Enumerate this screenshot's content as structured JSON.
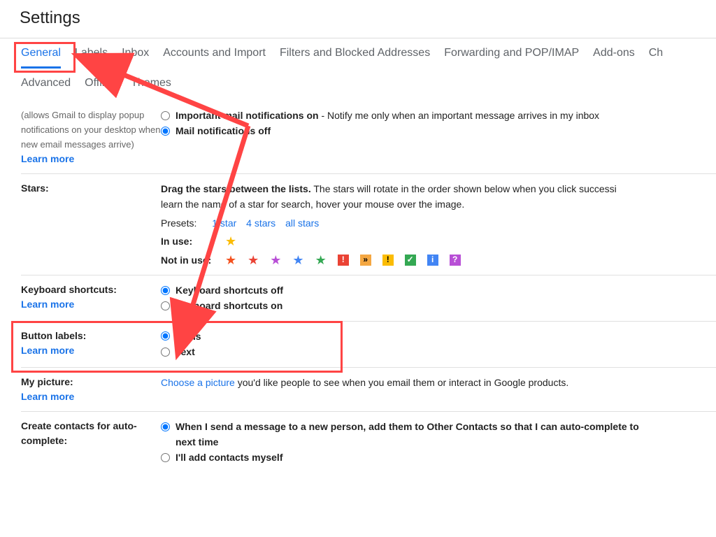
{
  "title": "Settings",
  "tabs_row1": [
    "General",
    "Labels",
    "Inbox",
    "Accounts and Import",
    "Filters and Blocked Addresses",
    "Forwarding and POP/IMAP",
    "Add-ons",
    "Ch"
  ],
  "tabs_row2": [
    "Advanced",
    "Offline",
    "Themes"
  ],
  "notifications": {
    "desc": "(allows Gmail to display popup notifications on your desktop when new email messages arrive)",
    "learn_more": "Learn more",
    "opt1_bold": "Important mail notifications on",
    "opt1_rest": " - Notify me only when an important message arrives in my inbox",
    "opt2": "Mail notifications off"
  },
  "stars": {
    "label": "Stars:",
    "drag_bold": "Drag the stars between the lists.",
    "drag_rest": "  The stars will rotate in the order shown below when you click successi",
    "drag_line2": "learn the name of a star for search, hover your mouse over the image.",
    "presets_label": "Presets:",
    "preset_links": [
      "1 star",
      "4 stars",
      "all stars"
    ],
    "in_use": "In use:",
    "not_in_use": "Not in use:"
  },
  "keyboard": {
    "label": "Keyboard shortcuts:",
    "learn_more": "Learn more",
    "off": "Keyboard shortcuts off",
    "on": "Keyboard shortcuts on"
  },
  "buttonlabels": {
    "label": "Button labels:",
    "learn_more": "Learn more",
    "icons": "Icons",
    "text": "Text"
  },
  "mypicture": {
    "label": "My picture:",
    "learn_more": "Learn more",
    "link": "Choose a picture",
    "rest": " you'd like people to see when you email them or interact in Google products."
  },
  "contacts": {
    "label": "Create contacts for auto-complete:",
    "opt1": "When I send a message to a new person, add them to Other Contacts so that I can auto-complete to",
    "opt1_line2": "next time",
    "opt2": "I'll add contacts myself"
  }
}
